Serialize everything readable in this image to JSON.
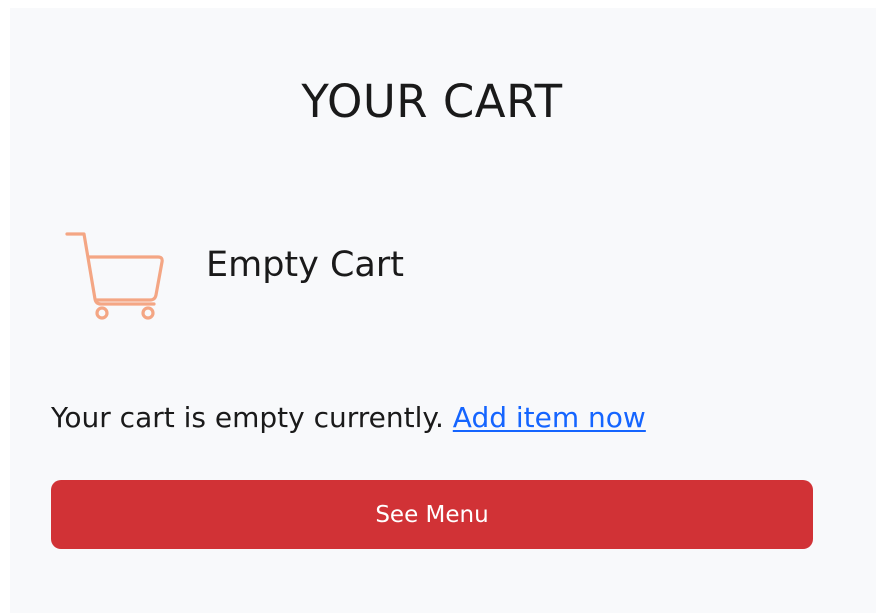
{
  "header": {
    "title": "YOUR CART"
  },
  "cart": {
    "icon": "shopping-cart-icon",
    "icon_color": "#f4a684",
    "empty_label": "Empty Cart",
    "message": "Your cart is empty currently.",
    "add_link_label": "Add item now",
    "link_color": "#1565ff"
  },
  "actions": {
    "see_menu_label": "See Menu",
    "button_color": "#d13236"
  }
}
